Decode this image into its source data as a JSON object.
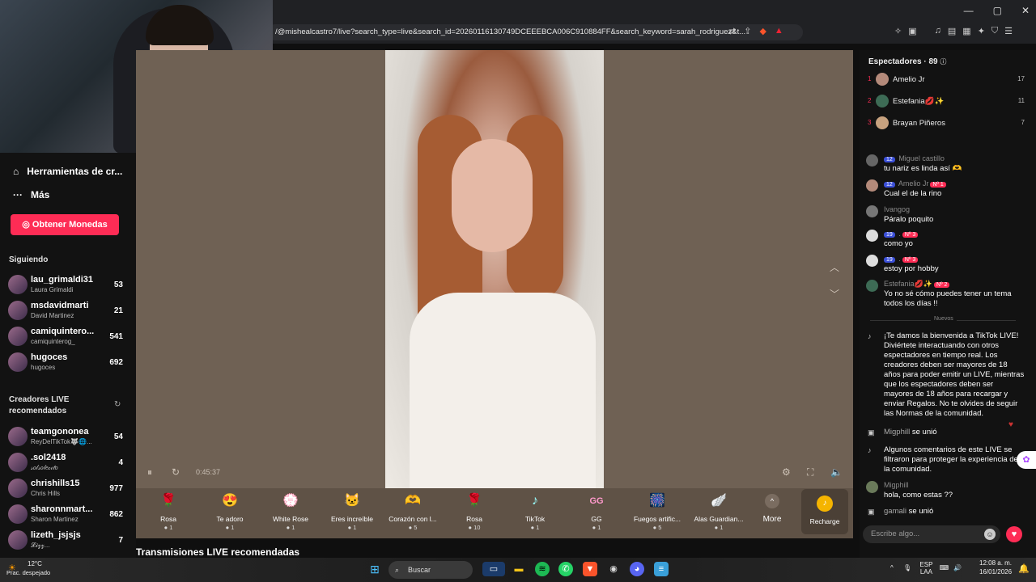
{
  "browser": {
    "url": "/@mishealcastro7/live?search_type=live&search_id=20260116130749DCEEEBCA006C910884FF&search_keyword=sarah_rodriguez&t..."
  },
  "sidebar": {
    "nav": [
      {
        "label": "Herramientas de cr...",
        "icon": "home-icon"
      },
      {
        "label": "Más",
        "icon": "more-icon"
      }
    ],
    "coins_button": "Obtener Monedas",
    "following_title": "Siguiendo",
    "following": [
      {
        "name": "lau_grimaldi31",
        "sub": "Laura Grimaldi",
        "count": "53"
      },
      {
        "name": "msdavidmarti",
        "sub": "David Martinez",
        "count": "21"
      },
      {
        "name": "camiquintero...",
        "sub": "camiquinterog_",
        "count": "541"
      },
      {
        "name": "hugoces",
        "sub": "hugoces",
        "count": "692"
      }
    ],
    "recommended_title": "Creadores LIVE recomendados",
    "recommended": [
      {
        "name": "teamgononea",
        "sub": "ReyDelTikTok🐺🌐...",
        "count": "54"
      },
      {
        "name": ".sol2418",
        "sub": "𝓈𝑜𝓁𝓈𝑜𝓁𝑒𝒸𝒾𝓉𝑜",
        "count": "4"
      },
      {
        "name": "chrishills15",
        "sub": "Chris Hills",
        "count": "977"
      },
      {
        "name": "sharonnmart...",
        "sub": "Sharon Martinez",
        "count": "862"
      },
      {
        "name": "lizeth_jsjsjs",
        "sub": "𝓛𝓲𝔃𝔃...",
        "count": "7"
      }
    ]
  },
  "player": {
    "timer": "0:45:37"
  },
  "gifts": [
    {
      "label": "Rosa",
      "price": "1",
      "icon": "rose-icon",
      "glyph": "🌹"
    },
    {
      "label": "Te adoro",
      "price": "1",
      "icon": "heart-icon",
      "glyph": "😍"
    },
    {
      "label": "White Rose",
      "price": "1",
      "icon": "white-rose-icon",
      "glyph": "💮"
    },
    {
      "label": "Eres increíble",
      "price": "1",
      "icon": "cat-icon",
      "glyph": "🐱"
    },
    {
      "label": "Corazón con l...",
      "price": "5",
      "icon": "heart-hands-icon",
      "glyph": "🫶"
    },
    {
      "label": "Rosa",
      "price": "10",
      "icon": "rose-icon",
      "glyph": "🌹"
    },
    {
      "label": "TikTok",
      "price": "1",
      "icon": "tiktok-icon",
      "glyph": "♪"
    },
    {
      "label": "GG",
      "price": "1",
      "icon": "gg-icon",
      "glyph": "GG"
    },
    {
      "label": "Fuegos artific...",
      "price": "5",
      "icon": "fireworks-icon",
      "glyph": "🎆"
    },
    {
      "label": "Alas Guardian...",
      "price": "1",
      "icon": "wings-icon",
      "glyph": "🪽"
    }
  ],
  "gifts_more": "More",
  "recharge": "Recharge",
  "recommended_streams_title": "Transmisiones LIVE recomendadas",
  "chat": {
    "viewers_label": "Espectadores · 89",
    "top_viewers": [
      {
        "rank": "1",
        "name": "Amelio Jr",
        "score": "17"
      },
      {
        "rank": "2",
        "name": "Estefania💋✨",
        "score": "11"
      },
      {
        "rank": "3",
        "name": "Brayan Piñeros",
        "score": "7"
      }
    ],
    "messages": [
      {
        "user": "Miguel castillo",
        "level": "12",
        "text": "tu nariz es linda así 🫶"
      },
      {
        "user": "Amelio Jr",
        "level": "12",
        "rank_badge": "Nº 1",
        "text": "Cual el de la rino"
      },
      {
        "user": "Ivangog",
        "text": "Páralo poquito"
      },
      {
        "user": ".",
        "level": "19",
        "rank_badge": "Nº 3",
        "text": "como yo"
      },
      {
        "user": ".",
        "level": "19",
        "rank_badge": "Nº 3",
        "text": "estoy por hobby"
      },
      {
        "user": "Estefania💋✨",
        "rank_badge": "Nº 2",
        "text": "Yo no sé cómo puedes tener un tema todos los días !!"
      }
    ],
    "new_divider": "Nuevos",
    "welcome": "¡Te damos la bienvenida a TikTok LIVE! Diviértete interactuando con otros espectadores en tiempo real. Los creadores deben ser mayores de 18 años para poder emitir un LIVE, mientras que los espectadores deben ser mayores de 18 años para recargar y enviar Regalos. No te olvides de seguir las Normas de la comunidad.",
    "joined1_user": "Migphill",
    "joined1_text": "se unió",
    "filtered": "Algunos comentarios de este LIVE se filtraron para proteger la experiencia de la comunidad.",
    "msg_after": {
      "user": "Migphill",
      "text": "hola, como estas ??"
    },
    "joined2_user": "gamali",
    "joined2_text": "se unió",
    "input_placeholder": "Escribe algo..."
  },
  "taskbar": {
    "temp": "12°C",
    "weather": "Prac. despejado",
    "search": "Buscar",
    "lang1": "ESP",
    "lang2": "LAA",
    "time": "12:08 a. m.",
    "date": "16/01/2026"
  },
  "colors": {
    "accent": "#fe2c55",
    "stage": "#6f6154",
    "panel": "#121212"
  }
}
